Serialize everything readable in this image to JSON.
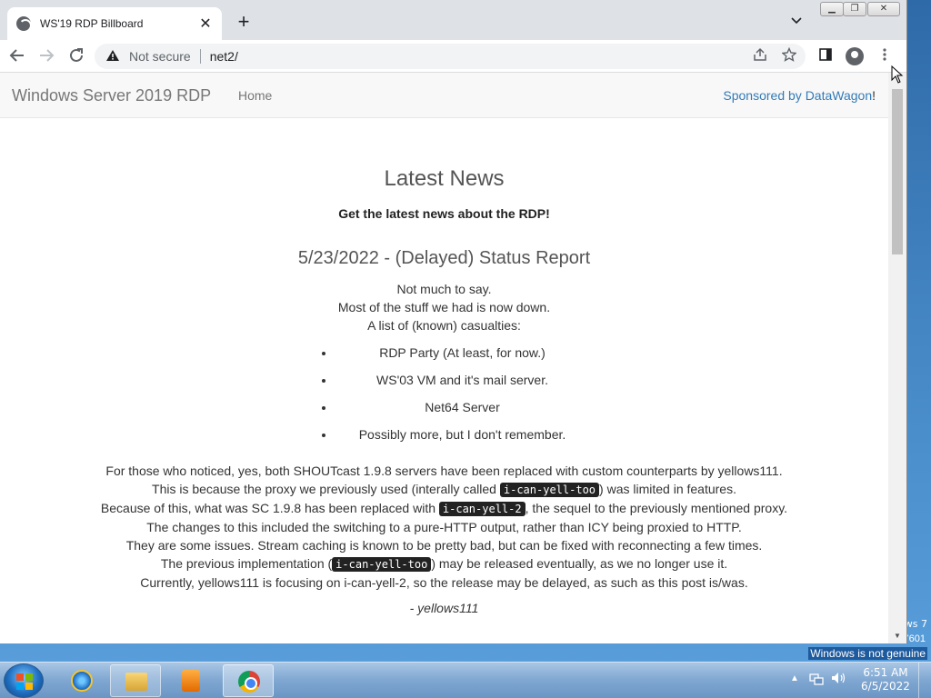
{
  "browser": {
    "tab_title": "WS'19 RDP Billboard",
    "tab_close": "✕",
    "new_tab": "+",
    "security_label": "Not secure",
    "url": "net2/"
  },
  "site": {
    "brand": "Windows Server 2019 RDP",
    "nav_home": "Home",
    "sponsor_prefix": "Sponsored by ",
    "sponsor_name": "DataWagon",
    "sponsor_suffix": "!"
  },
  "news": {
    "title": "Latest News",
    "subtitle": "Get the latest news about the RDP!",
    "post": {
      "title": "5/23/2022 - (Delayed) Status Report",
      "intro": [
        "Not much to say.",
        "Most of the stuff we had is now down.",
        "A list of (known) casualties:"
      ],
      "casualties": [
        "RDP Party (At least, for now.)",
        "WS'03 VM and it's mail server.",
        "Net64 Server",
        "Possibly more, but I don't remember."
      ],
      "para1": "For those who noticed, yes, both SHOUTcast 1.9.8 servers have been replaced with custom counterparts by yellows111.",
      "para2_a": "This is because the proxy we previously used (interally called ",
      "para2_code": "i-can-yell-too",
      "para2_b": ") was limited in features.",
      "para3_a": "Because of this, what was SC 1.9.8 has been replaced with ",
      "para3_code": "i-can-yell-2",
      "para3_b": ", the sequel to the previously mentioned proxy.",
      "para4": "The changes to this included the switching to a pure-HTTP output, rather than ICY being proxied to HTTP.",
      "para5": "They are some issues. Stream caching is known to be pretty bad, but can be fixed with reconnecting a few times.",
      "para6_a": "The previous implementation (",
      "para6_code": "i-can-yell-too",
      "para6_b": ") may be released eventually, as we no longer use it.",
      "para7": "Currently, yellows111 is focusing on i-can-yell-2, so the release may be delayed, as such as this post is/was.",
      "signature": "- yellows111"
    }
  },
  "desktop": {
    "watermark_line1": "ws 7",
    "watermark_line2": "7601",
    "watermark_line3": "Windows is not genuine"
  },
  "taskbar": {
    "time": "6:51 AM",
    "date": "6/5/2022"
  },
  "colors": {
    "link": "#337ab7",
    "taskbar": "#7fa7d1"
  }
}
